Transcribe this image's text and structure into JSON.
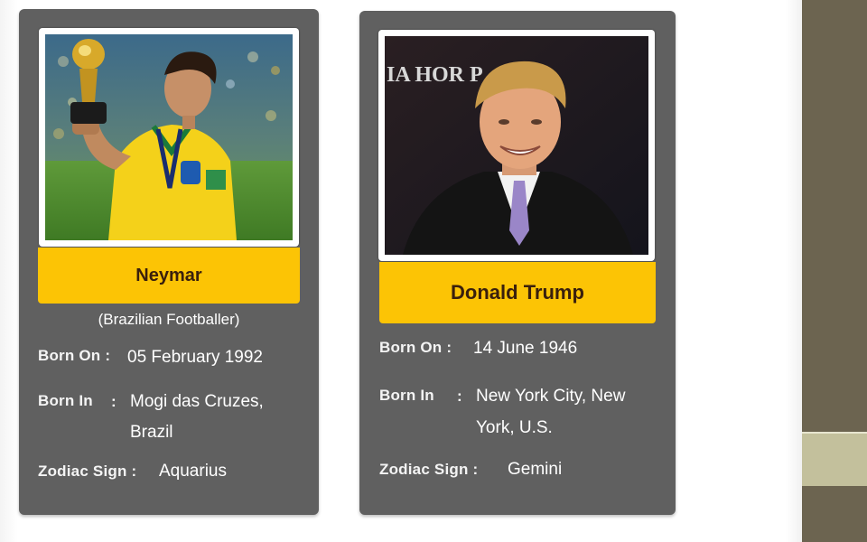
{
  "cards": [
    {
      "name": "Neymar",
      "subtitle": "(Brazilian Footballer)",
      "born_on_label": "Born On :",
      "born_on": "05 February 1992",
      "born_in_label": "Born In",
      "born_in_sep": ":",
      "born_in_line1": "Mogi das Cruzes,",
      "born_in_line2": "Brazil",
      "zodiac_label": "Zodiac Sign :",
      "zodiac": "Aquarius"
    },
    {
      "name": "Donald Trump",
      "born_on_label": "Born On :",
      "born_on": "14 June 1946",
      "born_in_label": "Born In",
      "born_in_sep": ":",
      "born_in_line1": "New York City, New",
      "born_in_line2": "York, U.S.",
      "zodiac_label": "Zodiac Sign :",
      "zodiac": "Gemini",
      "photo_backdrop_text": "IA   HOR   P"
    }
  ],
  "colors": {
    "card_bg": "#606060",
    "name_band": "#fcc405",
    "name_text": "#3a200d",
    "side_panel": "#6c6450",
    "side_stripe": "#c3c09c"
  }
}
